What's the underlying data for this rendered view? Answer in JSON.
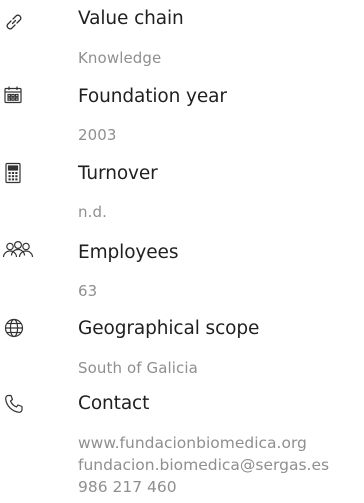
{
  "items": [
    {
      "icon": "link-icon",
      "title": "Value chain",
      "value": "Knowledge"
    },
    {
      "icon": "calendar-icon",
      "title": "Foundation year",
      "value": "2003"
    },
    {
      "icon": "calculator-icon",
      "title": "Turnover",
      "value": "n.d."
    },
    {
      "icon": "people-icon",
      "title": "Employees",
      "value": "63"
    },
    {
      "icon": "globe-icon",
      "title": "Geographical scope",
      "value": "South of Galicia"
    }
  ],
  "contact": {
    "icon": "phone-icon",
    "title": "Contact",
    "website": "www.fundacionbiomedica.org",
    "email": "fundacion.biomedica@sergas.es",
    "phone": "986 217 460"
  }
}
